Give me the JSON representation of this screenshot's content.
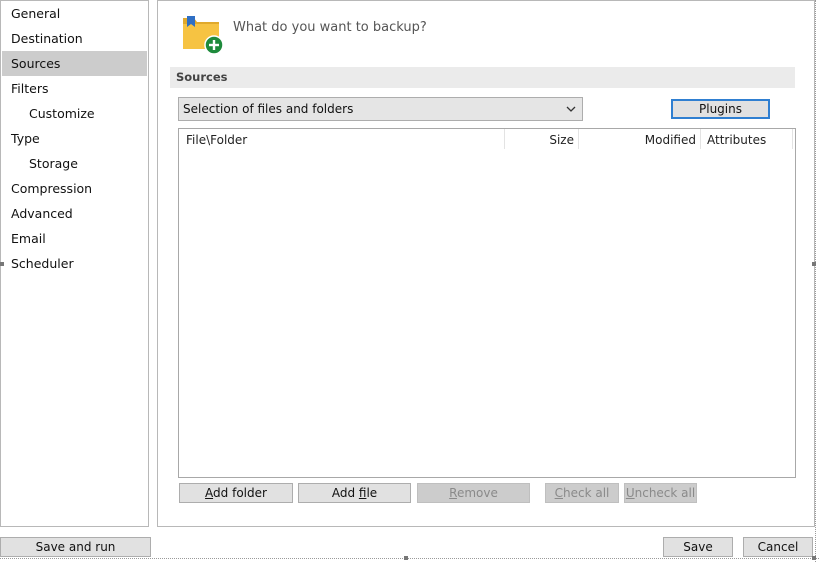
{
  "sidebar": {
    "items": [
      {
        "label": "General",
        "sub": false,
        "selected": false
      },
      {
        "label": "Destination",
        "sub": false,
        "selected": false
      },
      {
        "label": "Sources",
        "sub": false,
        "selected": true
      },
      {
        "label": "Filters",
        "sub": false,
        "selected": false
      },
      {
        "label": "Customize",
        "sub": true,
        "selected": false
      },
      {
        "label": "Type",
        "sub": false,
        "selected": false
      },
      {
        "label": "Storage",
        "sub": true,
        "selected": false
      },
      {
        "label": "Compression",
        "sub": false,
        "selected": false
      },
      {
        "label": "Advanced",
        "sub": false,
        "selected": false
      },
      {
        "label": "Email",
        "sub": false,
        "selected": false
      },
      {
        "label": "Scheduler",
        "sub": false,
        "selected": false
      }
    ]
  },
  "main": {
    "prompt": "What do you want to backup?",
    "section_title": "Sources",
    "source_type": {
      "selected": "Selection of files and folders"
    },
    "plugins_label": "Plugins",
    "file_list": {
      "columns": [
        "File\\Folder",
        "Size",
        "Modified",
        "Attributes"
      ]
    },
    "actions": {
      "add_folder": {
        "pre": "",
        "key": "A",
        "post": "dd folder"
      },
      "add_file": {
        "pre": "Add ",
        "key": "f",
        "post": "ile"
      },
      "remove": {
        "pre": "",
        "key": "R",
        "post": "emove"
      },
      "check_all": {
        "pre": "",
        "key": "C",
        "post": "heck all"
      },
      "uncheck_all": {
        "pre": "",
        "key": "U",
        "post": "ncheck all"
      }
    }
  },
  "footer": {
    "save_and_run": "Save and run",
    "save": "Save",
    "cancel": "Cancel"
  },
  "colors": {
    "selected_nav": "#cccccc",
    "focus_border": "#2f7fd1",
    "folder_yellow": "#f6c342",
    "add_badge_green": "#1e8a3c"
  },
  "icons": {
    "prompt_icon": "folder-add-icon",
    "dropdown_icon": "chevron-down-icon"
  }
}
